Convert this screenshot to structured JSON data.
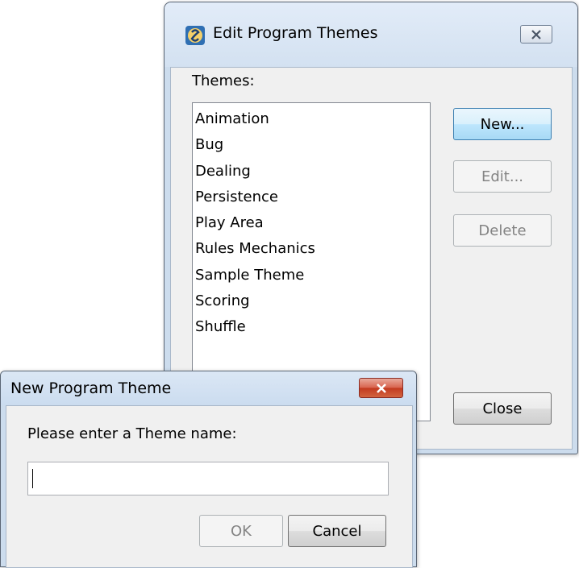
{
  "edit_dialog": {
    "title": "Edit Program Themes",
    "themes_label": "Themes:",
    "themes": [
      "Animation",
      "Bug",
      "Dealing",
      "Persistence",
      "Play Area",
      "Rules Mechanics",
      "Sample Theme",
      "Scoring",
      "Shuffle"
    ],
    "new_label": "New...",
    "edit_label": "Edit...",
    "delete_label": "Delete",
    "close_label": "Close"
  },
  "new_dialog": {
    "title": "New Program Theme",
    "prompt": "Please enter a Theme name:",
    "input_value": "",
    "ok_label": "OK",
    "cancel_label": "Cancel"
  }
}
